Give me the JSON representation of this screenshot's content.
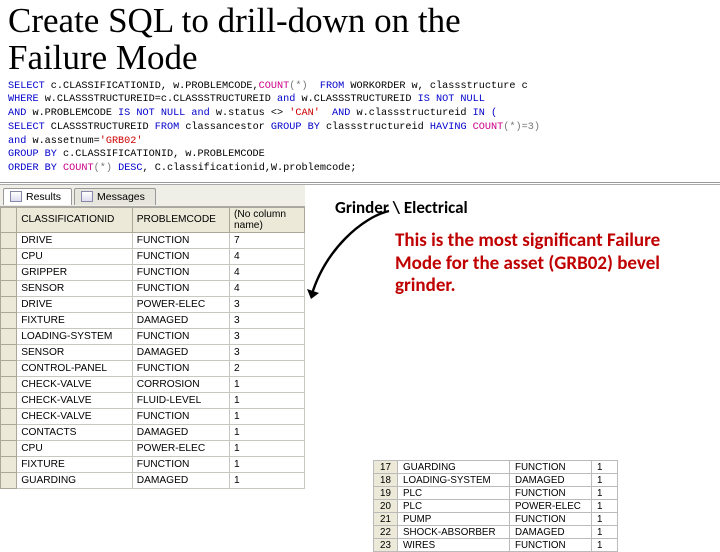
{
  "title_line1": "Create SQL to drill-down on the",
  "title_line2": "Failure Mode",
  "sql": {
    "l1a": "SELECT",
    "l1b": " c.CLASSIFICATIONID, w.PROBLEMCODE,",
    "l1c": "COUNT",
    "l1d": "(*)  ",
    "l1e": "FROM",
    "l1f": " WORKORDER w, classstructure c",
    "l2a": "WHERE",
    "l2b": " w.CLASSSTRUCTUREID=c.CLASSSTRUCTUREID ",
    "l2c": "and",
    "l2d": " w.CLASSSTRUCTUREID ",
    "l2e": "IS NOT NULL",
    "l3a": "AND",
    "l3b": " w.PROBLEMCODE ",
    "l3c": "IS NOT NULL and",
    "l3d": " w.status <> ",
    "l3e": "'CAN'",
    "l3f": "  ",
    "l3g": "AND",
    "l3h": " w.classstructureid ",
    "l3i": "IN (",
    "l4a": "SELECT",
    "l4b": " CLASSSTRUCTUREID ",
    "l4c": "FROM",
    "l4d": " classancestor ",
    "l4e": "GROUP BY",
    "l4f": " classstructureid ",
    "l4g": "HAVING ",
    "l4h": "COUNT",
    "l4i": "(*)=3)",
    "l5a": "and",
    "l5b": " w.assetnum=",
    "l5c": "'GRB02'",
    "l6a": "GROUP BY",
    "l6b": " c.CLASSIFICATIONID, w.PROBLEMCODE",
    "l7a": "ORDER BY ",
    "l7b": "COUNT",
    "l7c": "(*) ",
    "l7d": "DESC",
    "l7e": ", C.classificationid,W.problemcode;"
  },
  "tabs": {
    "results": "Results",
    "messages": "Messages"
  },
  "headers": {
    "class": "CLASSIFICATIONID",
    "prob": "PROBLEMCODE",
    "count": "(No column name)"
  },
  "rows": [
    {
      "c": "DRIVE",
      "p": "FUNCTION",
      "n": "7"
    },
    {
      "c": "CPU",
      "p": "FUNCTION",
      "n": "4"
    },
    {
      "c": "GRIPPER",
      "p": "FUNCTION",
      "n": "4"
    },
    {
      "c": "SENSOR",
      "p": "FUNCTION",
      "n": "4"
    },
    {
      "c": "DRIVE",
      "p": "POWER-ELEC",
      "n": "3"
    },
    {
      "c": "FIXTURE",
      "p": "DAMAGED",
      "n": "3"
    },
    {
      "c": "LOADING-SYSTEM",
      "p": "FUNCTION",
      "n": "3"
    },
    {
      "c": "SENSOR",
      "p": "DAMAGED",
      "n": "3"
    },
    {
      "c": "CONTROL-PANEL",
      "p": "FUNCTION",
      "n": "2"
    },
    {
      "c": "CHECK-VALVE",
      "p": "CORROSION",
      "n": "1"
    },
    {
      "c": "CHECK-VALVE",
      "p": "FLUID-LEVEL",
      "n": "1"
    },
    {
      "c": "CHECK-VALVE",
      "p": "FUNCTION",
      "n": "1"
    },
    {
      "c": "CONTACTS",
      "p": "DAMAGED",
      "n": "1"
    },
    {
      "c": "CPU",
      "p": "POWER-ELEC",
      "n": "1"
    },
    {
      "c": "FIXTURE",
      "p": "FUNCTION",
      "n": "1"
    },
    {
      "c": "GUARDING",
      "p": "DAMAGED",
      "n": "1"
    }
  ],
  "annot_top": "Grinder \\ Electrical",
  "annot_main": "This is the most significant Failure Mode for the asset (GRB02) bevel grinder.",
  "mini": [
    {
      "i": "17",
      "c": "GUARDING",
      "p": "FUNCTION",
      "n": "1"
    },
    {
      "i": "18",
      "c": "LOADING-SYSTEM",
      "p": "DAMAGED",
      "n": "1"
    },
    {
      "i": "19",
      "c": "PLC",
      "p": "FUNCTION",
      "n": "1"
    },
    {
      "i": "20",
      "c": "PLC",
      "p": "POWER-ELEC",
      "n": "1"
    },
    {
      "i": "21",
      "c": "PUMP",
      "p": "FUNCTION",
      "n": "1"
    },
    {
      "i": "22",
      "c": "SHOCK-ABSORBER",
      "p": "DAMAGED",
      "n": "1"
    },
    {
      "i": "23",
      "c": "WIRES",
      "p": "FUNCTION",
      "n": "1"
    }
  ]
}
